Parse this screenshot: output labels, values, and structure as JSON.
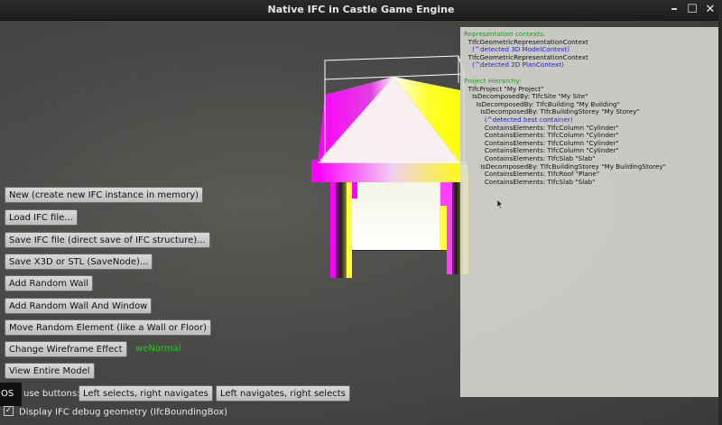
{
  "window": {
    "title": "Native IFC in Castle Game Engine",
    "minimize_glyph": "–",
    "maximize_glyph": "☐",
    "close_glyph": "✕"
  },
  "info_panel": {
    "representation_header": "Representation contexts:",
    "contexts": [
      {
        "line": "  TIfcGeometricRepresentationContext",
        "style": "normal"
      },
      {
        "line": "    (^detected 3D ModelContext)",
        "style": "detected"
      },
      {
        "line": "  TIfcGeometricRepresentationContext",
        "style": "normal"
      },
      {
        "line": "    (^detected 2D PlanContext)",
        "style": "detected"
      }
    ],
    "hierarchy_header": "Project Hierarchy:",
    "hierarchy": [
      {
        "line": "  TIfcProject \"My Project\"",
        "style": "normal"
      },
      {
        "line": "    IsDecomposedBy: TIfcSite \"My Site\"",
        "style": "normal"
      },
      {
        "line": "      IsDecomposedBy: TIfcBuilding \"My Building\"",
        "style": "normal"
      },
      {
        "line": "        IsDecomposedBy: TIfcBuildingStorey \"My Storey\"",
        "style": "normal"
      },
      {
        "line": "          (^detected best container)",
        "style": "detected"
      },
      {
        "line": "          ContainsElements: TIfcColumn \"Cylinder\"",
        "style": "normal"
      },
      {
        "line": "          ContainsElements: TIfcColumn \"Cylinder\"",
        "style": "normal"
      },
      {
        "line": "          ContainsElements: TIfcColumn \"Cylinder\"",
        "style": "normal"
      },
      {
        "line": "          ContainsElements: TIfcColumn \"Cylinder\"",
        "style": "normal"
      },
      {
        "line": "          ContainsElements: TIfcSlab \"Slab\"",
        "style": "normal"
      },
      {
        "line": "        IsDecomposedBy: TIfcBuildingStorey \"My BuildingStorey\"",
        "style": "normal"
      },
      {
        "line": "          ContainsElements: TIfcRoof \"Plane\"",
        "style": "normal"
      },
      {
        "line": "          ContainsElements: TIfcSlab \"Slab\"",
        "style": "normal"
      }
    ]
  },
  "buttons": {
    "new": "New (create new IFC instance in memory)",
    "load": "Load IFC file...",
    "save_ifc": "Save IFC file (direct save of IFC structure)...",
    "save_x3d": "Save X3D or STL (SaveNode)...",
    "add_wall": "Add Random Wall",
    "add_wall_window": "Add Random Wall And Window",
    "move_element": "Move Random Element (like a Wall or Floor)",
    "change_wireframe": "Change Wireframe Effect",
    "view_entire": "View Entire Model",
    "left_selects": "Left selects, right navigates",
    "left_navigates": "Left navigates, right selects"
  },
  "wireframe_effect_value": "weNormal",
  "mouse_buttons_label": "use buttons:",
  "os_badge": "OS",
  "debug_checkbox": {
    "checked": true,
    "mark": "✓",
    "label": "Display IFC debug geometry (IfcBoundingBox)"
  },
  "colors": {
    "roof_magenta": "#ff00ff",
    "roof_yellow": "#ffff00",
    "status_green": "#1ed21e",
    "detected_blue": "#2222cc",
    "header_green": "#1a9e1a"
  }
}
